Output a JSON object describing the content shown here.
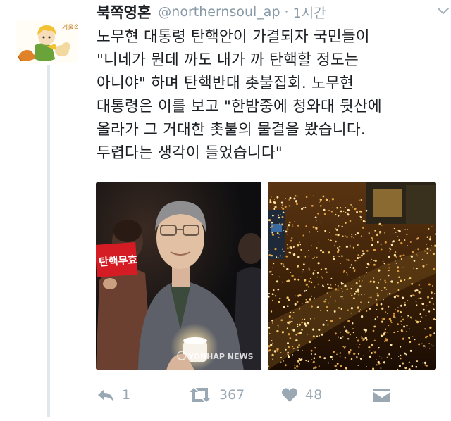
{
  "tweet": {
    "author_name": "북쪽영혼",
    "handle": "@northernsoul_ap",
    "separator": "·",
    "time": "1시간",
    "avatar_caption": "거울속",
    "text_lines": [
      "노무현 대통령 탄핵안이 가결되자 국민들이",
      "\"니네가 뭔데 까도 내가 까 탄핵할 정도는",
      "아니야\" 하며 탄핵반대 촛불집회. 노무현",
      "대통령은 이를 보고 \"한밤중에 청와대 뒷산에",
      "올라가 그 거대한 촛불의 물결을 봤습니다.",
      "두렵다는 생각이 들었습니다\""
    ]
  },
  "media": {
    "left_photo": {
      "sign_text": "탄핵무효",
      "watermark": "YONHAP NEWS"
    }
  },
  "actions": {
    "reply_count": "1",
    "retweet_count": "367",
    "like_count": "48"
  },
  "colors": {
    "text": "#1c2024",
    "secondary": "#8899a6",
    "icon": "#9aa8b3",
    "thread_line": "#e1e8ed"
  }
}
